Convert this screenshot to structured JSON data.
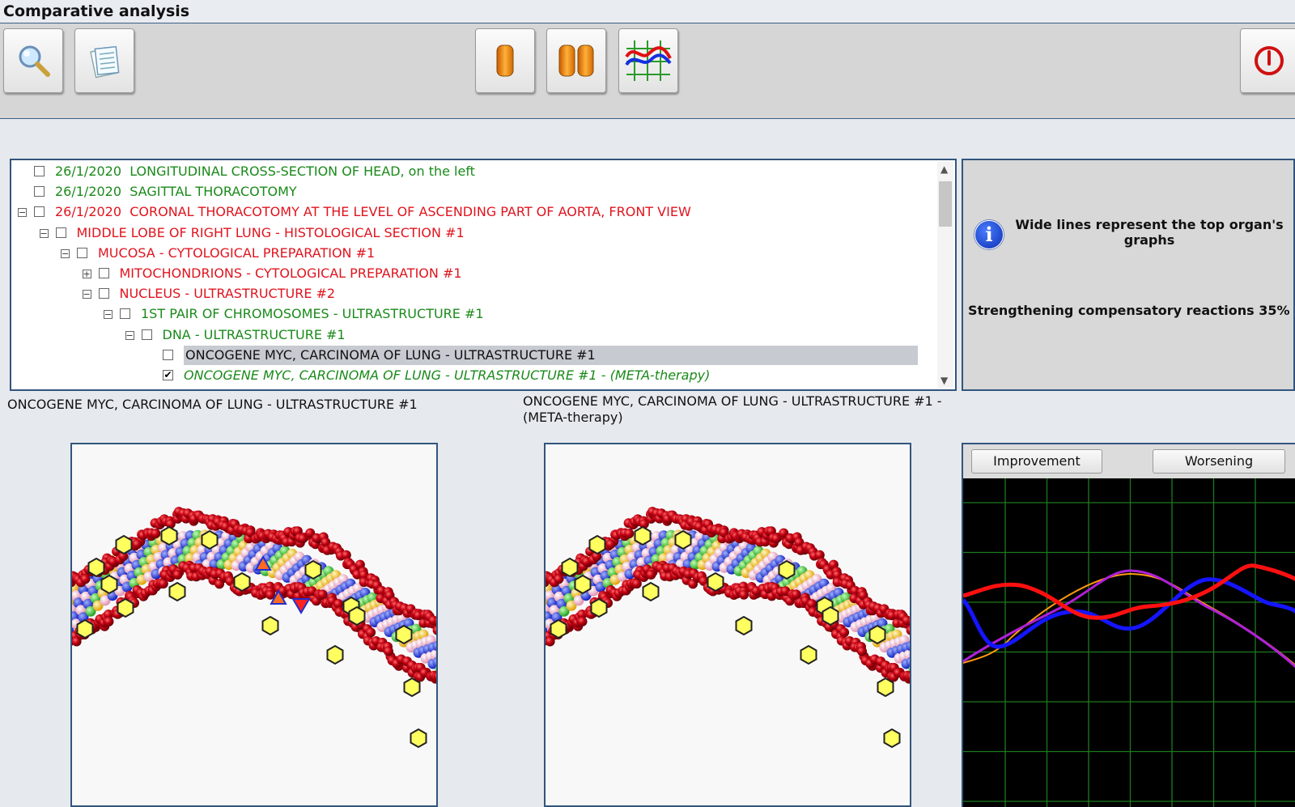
{
  "window": {
    "title": "Comparative analysis"
  },
  "toolbar": {
    "buttons": [
      {
        "name": "search-button",
        "icon": "magnifier-icon"
      },
      {
        "name": "notes-button",
        "icon": "notepad-icon"
      },
      {
        "name": "single-view-button",
        "icon": "single-capsule-icon"
      },
      {
        "name": "dual-view-button",
        "icon": "double-capsule-icon"
      },
      {
        "name": "graph-view-button",
        "icon": "graph-icon"
      },
      {
        "name": "exit-button",
        "icon": "power-icon"
      }
    ]
  },
  "tree": {
    "items": [
      {
        "date": "26/1/2020",
        "label": "LONGITUDINAL CROSS-SECTION OF HEAD, on the left",
        "color": "green",
        "level": 0,
        "expander": "",
        "checked": false
      },
      {
        "date": "26/1/2020",
        "label": "SAGITTAL THORACOTOMY",
        "color": "green",
        "level": 0,
        "expander": "",
        "checked": false
      },
      {
        "date": "26/1/2020",
        "label": "CORONAL THORACOTOMY AT THE LEVEL OF ASCENDING PART OF AORTA, FRONT VIEW",
        "color": "red",
        "level": 0,
        "expander": "⊟",
        "checked": false
      },
      {
        "date": "",
        "label": "MIDDLE LOBE OF RIGHT LUNG - HISTOLOGICAL SECTION #1",
        "color": "red",
        "level": 1,
        "expander": "⊟",
        "checked": false
      },
      {
        "date": "",
        "label": "MUCOSA - CYTOLOGICAL PREPARATION #1",
        "color": "red",
        "level": 2,
        "expander": "⊟",
        "checked": false
      },
      {
        "date": "",
        "label": "MITOCHONDRIONS - CYTOLOGICAL PREPARATION #1",
        "color": "red",
        "level": 3,
        "expander": "⊞",
        "checked": false
      },
      {
        "date": "",
        "label": "NUCLEUS - ULTRASTRUCTURE #2",
        "color": "red",
        "level": 3,
        "expander": "⊟",
        "checked": false
      },
      {
        "date": "",
        "label": "1ST PAIR OF CHROMOSOMES - ULTRASTRUCTURE #1",
        "color": "green",
        "level": 4,
        "expander": "⊟",
        "checked": false
      },
      {
        "date": "",
        "label": "DNA - ULTRASTRUCTURE #1",
        "color": "green",
        "level": 5,
        "expander": "⊟",
        "checked": false
      },
      {
        "date": "",
        "label": "ONCOGENE MYC, CARCINOMA OF LUNG - ULTRASTRUCTURE #1",
        "color": "black",
        "level": 6,
        "expander": "",
        "checked": false,
        "selected": true
      },
      {
        "date": "",
        "label": "ONCOGENE MYC, CARCINOMA OF LUNG - ULTRASTRUCTURE #1 - (META-therapy)",
        "color": "green",
        "level": 6,
        "expander": "",
        "checked": true,
        "italic": true
      }
    ]
  },
  "info": {
    "icon": "info-icon",
    "text": "Wide lines represent the top organ's graphs",
    "strength": "Strengthening compensatory reactions 35%"
  },
  "captions": {
    "left": "ONCOGENE MYC, CARCINOMA OF LUNG - ULTRASTRUCTURE #1",
    "right_line1": "ONCOGENE MYC, CARCINOMA OF LUNG - ULTRASTRUCTURE #1 -",
    "right_line2": "(META-therapy)"
  },
  "graph_panel": {
    "improvement_label": "Improvement",
    "worsening_label": "Worsening"
  },
  "colors": {
    "tree_green": "#1a8a1a",
    "tree_red": "#e0141e",
    "graph_red": "#ff1010",
    "graph_blue": "#1515ff",
    "graph_purple": "#b020d8",
    "graph_orange": "#ff9a10",
    "grid": "#1e7a1e"
  }
}
